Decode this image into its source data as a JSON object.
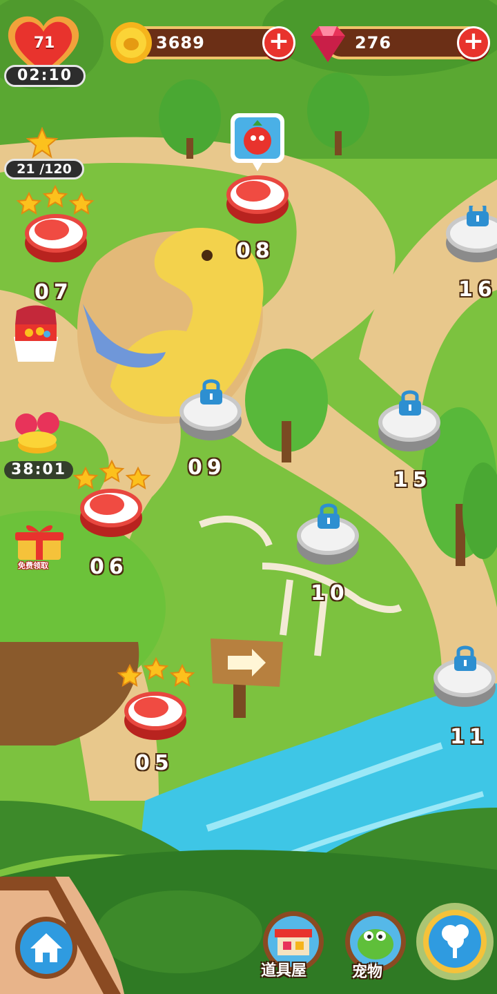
{
  "hud": {
    "lives": "71",
    "lives_timer": "02:10",
    "coins": "3689",
    "gems": "276",
    "stars_progress": "21 /120",
    "add_label": "+"
  },
  "side_panel": {
    "gift_timer": "38:01",
    "free_gift_label": "免费领取"
  },
  "levels": [
    {
      "number": "05",
      "state": "completed",
      "stars": 3
    },
    {
      "number": "06",
      "state": "completed",
      "stars": 3
    },
    {
      "number": "07",
      "state": "completed",
      "stars": 3
    },
    {
      "number": "08",
      "state": "current",
      "stars": 0
    },
    {
      "number": "09",
      "state": "locked",
      "stars": 0
    },
    {
      "number": "10",
      "state": "locked",
      "stars": 0
    },
    {
      "number": "11",
      "state": "locked",
      "stars": 0
    },
    {
      "number": "15",
      "state": "locked",
      "stars": 0
    },
    {
      "number": "16",
      "state": "locked",
      "stars": 0
    }
  ],
  "bottom_nav": {
    "shop_label": "道具屋",
    "pet_label": "宠物"
  },
  "colors": {
    "level_red": "#e8473f",
    "locked_grey": "#c9c9c9",
    "path": "#e8c88c",
    "grass": "#7cc23f",
    "water": "#3ec6e6"
  },
  "icons": {
    "home": "home-icon",
    "lock": "lock-icon",
    "tree": "tree-icon"
  }
}
